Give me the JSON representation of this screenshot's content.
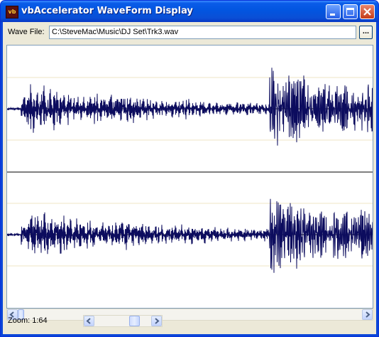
{
  "window": {
    "title": "vbAccelerator WaveForm Display",
    "icon_text": "vb"
  },
  "titlebar_buttons": {
    "minimize_icon": "minimize-icon",
    "maximize_icon": "maximize-icon",
    "close_icon": "close-icon"
  },
  "wave_file": {
    "label": "Wave File:",
    "path": "C:\\SteveMac\\Music\\DJ Set\\Trk3.wav",
    "browse_label": "..."
  },
  "zoom": {
    "label": "Zoom: 1:64"
  },
  "colors": {
    "waveform": "#0c0c5e",
    "centerline": "#000000",
    "gridline": "#efe6c4",
    "frame": "#ece9d8"
  }
}
